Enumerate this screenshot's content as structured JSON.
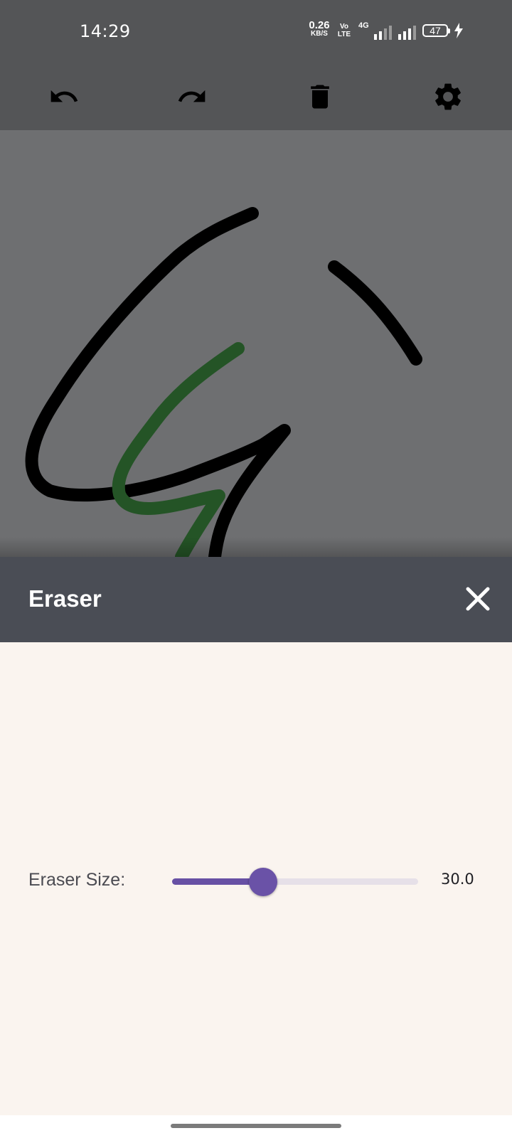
{
  "status_bar": {
    "time": "14:29",
    "net_speed_value": "0.26",
    "net_speed_unit": "KB/S",
    "volte_label": "Vo\nLTE",
    "network_type": "4G",
    "battery_level": "47"
  },
  "toolbar": {
    "undo_icon": "undo-icon",
    "redo_icon": "redo-icon",
    "delete_icon": "trash-icon",
    "settings_icon": "gear-icon"
  },
  "colors": {
    "toolbar_bg": "#545557",
    "canvas_bg": "#6e6f71",
    "stroke_black": "#000000",
    "stroke_green": "#245426",
    "sheet_header_bg": "#4a4d55",
    "sheet_body_bg": "#faf4ef",
    "slider_accent": "#6750a4"
  },
  "sheet": {
    "title": "Eraser",
    "close_icon": "close-icon",
    "eraser_size_label": "Eraser Size:",
    "eraser_size_value": "30.0",
    "slider_fraction": 0.37
  }
}
